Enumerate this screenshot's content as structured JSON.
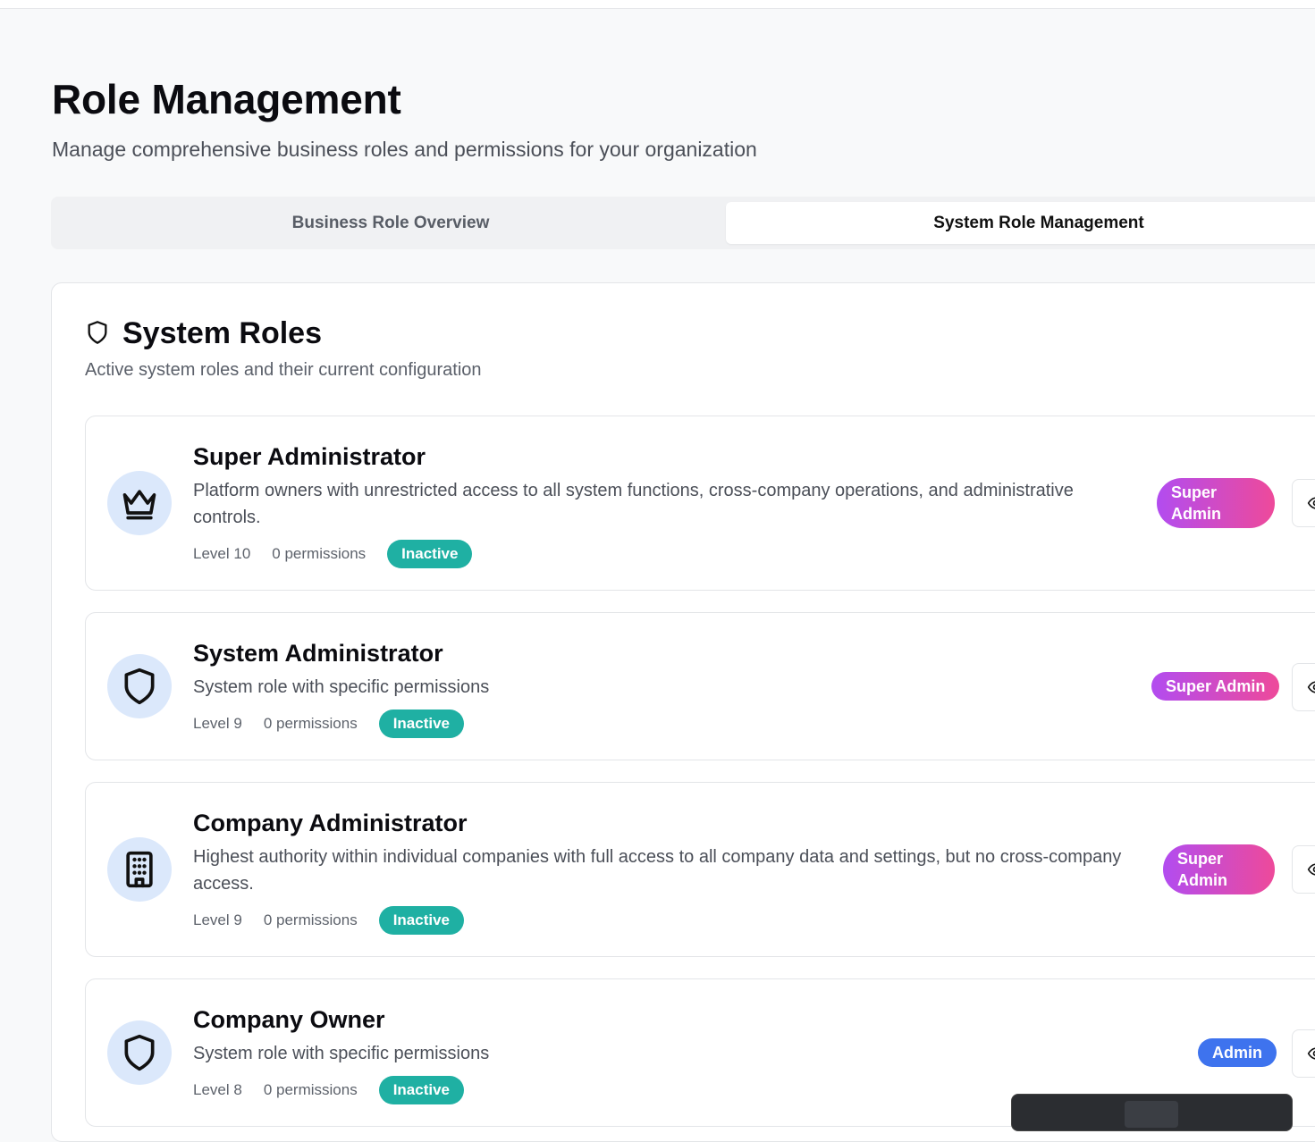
{
  "header": {
    "title": "Role Management",
    "subtitle": "Manage comprehensive business roles and permissions for your organization"
  },
  "tabs": [
    {
      "label": "Business Role Overview",
      "active": false
    },
    {
      "label": "System Role Management",
      "active": true
    }
  ],
  "panel": {
    "icon": "shield-icon",
    "title": "System Roles",
    "description": "Active system roles and their current configuration"
  },
  "roles": [
    {
      "icon": "crown-icon",
      "name": "Super Administrator",
      "description": "Platform owners with unrestricted access to all system functions, cross-company operations, and administrative controls.",
      "level": "Level 10",
      "permissions": "0 permissions",
      "status": "Inactive",
      "type_badge": "Super Admin"
    },
    {
      "icon": "shield-icon",
      "name": "System Administrator",
      "description": "System role with specific permissions",
      "level": "Level 9",
      "permissions": "0 permissions",
      "status": "Inactive",
      "type_badge": "Super Admin"
    },
    {
      "icon": "building-icon",
      "name": "Company Administrator",
      "description": "Highest authority within individual companies with full access to all company data and settings, but no cross-company access.",
      "level": "Level 9",
      "permissions": "0 permissions",
      "status": "Inactive",
      "type_badge": "Super Admin"
    },
    {
      "icon": "shield-icon",
      "name": "Company Owner",
      "description": "System role with specific permissions",
      "level": "Level 8",
      "permissions": "0 permissions",
      "status": "Inactive",
      "type_badge": "Admin"
    }
  ],
  "colors": {
    "status_inactive": "#1fb0a3",
    "super_admin_gradient_start": "#b24cf0",
    "super_admin_gradient_end": "#ee4a9a",
    "admin_badge": "#3e73ee",
    "avatar_bg": "#dbe8fb"
  }
}
